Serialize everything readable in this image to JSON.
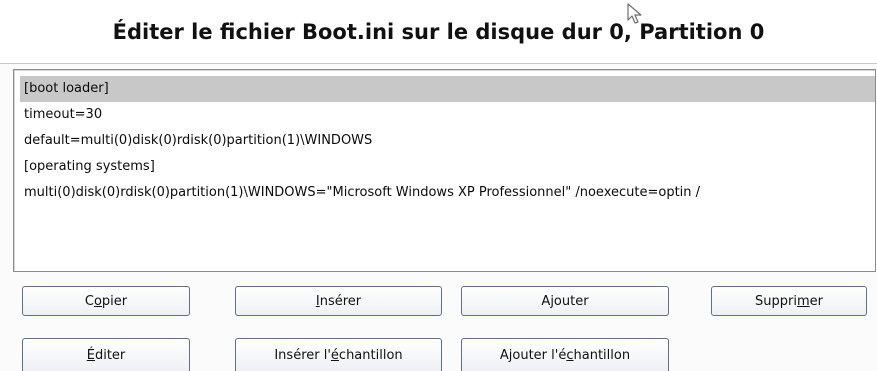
{
  "dialog": {
    "title": "Éditer le fichier Boot.ini sur le disque dur 0, Partition 0"
  },
  "editor": {
    "lines": [
      "[boot loader]",
      "timeout=30",
      "default=multi(0)disk(0)rdisk(0)partition(1)\\WINDOWS",
      "[operating systems]",
      "multi(0)disk(0)rdisk(0)partition(1)\\WINDOWS=\"Microsoft Windows XP Professionnel\" /noexecute=optin /"
    ],
    "selected_index": 0
  },
  "buttons": {
    "copy": {
      "pre": "C",
      "mnemonic": "o",
      "post": "pier"
    },
    "insert": {
      "pre": "",
      "mnemonic": "I",
      "post": "nsérer"
    },
    "append": {
      "pre": "",
      "mnemonic": "",
      "post": "Ajouter"
    },
    "delete": {
      "pre": "Suppri",
      "mnemonic": "m",
      "post": "er"
    },
    "edit": {
      "pre": "",
      "mnemonic": "É",
      "post": "diter"
    },
    "insert_sample": {
      "pre": "Insérer l'",
      "mnemonic": "é",
      "post": "chantillon"
    },
    "append_sample": {
      "pre": "Ajouter l'é",
      "mnemonic": "c",
      "post": "hantillon"
    }
  },
  "icons": {
    "cursor": "mouse-pointer-icon"
  },
  "colors": {
    "selection": "#c8c8c8",
    "button_border": "#5f6f86",
    "panel_border": "#8c8c8c"
  }
}
